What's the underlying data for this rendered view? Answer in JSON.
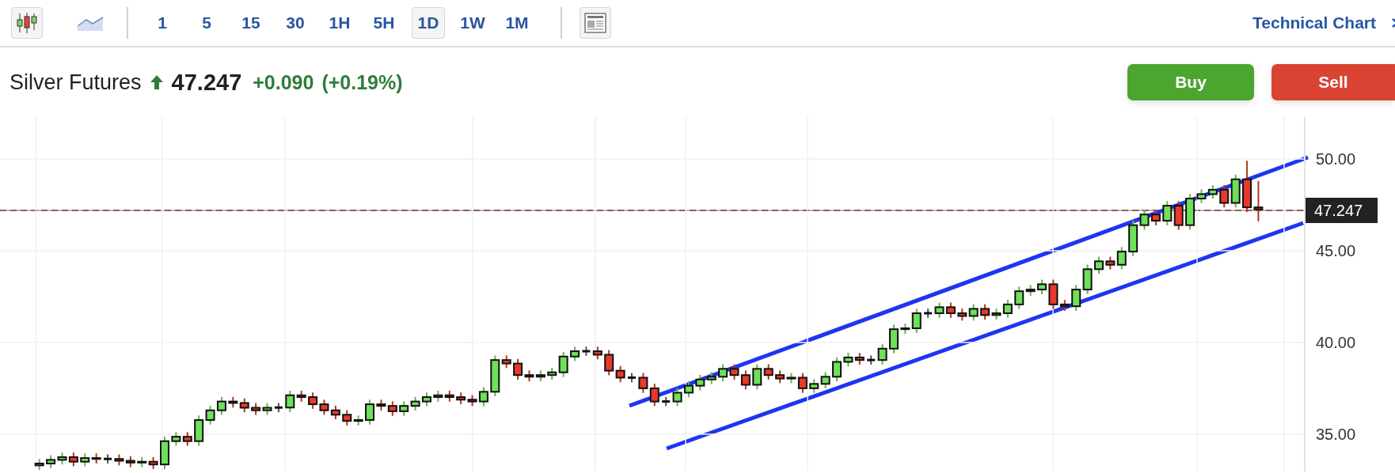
{
  "toolbar": {
    "chart_types": [
      {
        "kind": "candles",
        "selected": true
      },
      {
        "kind": "area",
        "selected": false
      }
    ],
    "intervals": [
      {
        "label": "1",
        "selected": false
      },
      {
        "label": "5",
        "selected": false
      },
      {
        "label": "15",
        "selected": false
      },
      {
        "label": "30",
        "selected": false
      },
      {
        "label": "1H",
        "selected": false
      },
      {
        "label": "5H",
        "selected": false
      },
      {
        "label": "1D",
        "selected": true
      },
      {
        "label": "1W",
        "selected": false
      },
      {
        "label": "1M",
        "selected": false
      }
    ],
    "link": "Technical Chart"
  },
  "quote": {
    "name": "Silver Futures",
    "price": "47.247",
    "change": "+0.090",
    "change_pct": "(+0.19%)"
  },
  "buttons": [
    {
      "kind": "buy",
      "label": "Buy"
    },
    {
      "kind": "sell",
      "label": "Sell"
    }
  ],
  "chart": {
    "chart_data": {
      "type": "candlestick",
      "grid": true,
      "ylim": [
        32.97,
        52.28
      ],
      "yticks": [
        {
          "value": 35,
          "label": "35.00"
        },
        {
          "value": 40,
          "label": "40.00"
        },
        {
          "value": 45,
          "label": "45.00"
        },
        {
          "value": 50,
          "label": "50.00"
        }
      ],
      "ohlc": [
        [
          33.3,
          33.65,
          33.05,
          33.4
        ],
        [
          33.4,
          33.85,
          33.15,
          33.6
        ],
        [
          33.6,
          34.0,
          33.35,
          33.75
        ],
        [
          33.75,
          34.0,
          33.25,
          33.5
        ],
        [
          33.5,
          33.95,
          33.25,
          33.7
        ],
        [
          33.7,
          33.95,
          33.4,
          33.65
        ],
        [
          33.65,
          33.9,
          33.4,
          33.65
        ],
        [
          33.65,
          33.9,
          33.3,
          33.55
        ],
        [
          33.55,
          33.8,
          33.2,
          33.45
        ],
        [
          33.45,
          33.75,
          33.2,
          33.5
        ],
        [
          33.5,
          33.75,
          33.1,
          33.35
        ],
        [
          33.35,
          34.87,
          33.1,
          34.62
        ],
        [
          34.62,
          35.11,
          34.37,
          34.86
        ],
        [
          34.86,
          35.11,
          34.37,
          34.62
        ],
        [
          34.62,
          36.02,
          34.37,
          35.77
        ],
        [
          35.77,
          36.55,
          35.52,
          36.3
        ],
        [
          36.3,
          37.03,
          36.05,
          36.78
        ],
        [
          36.78,
          37.03,
          36.45,
          36.7
        ],
        [
          36.7,
          36.95,
          36.19,
          36.44
        ],
        [
          36.44,
          36.69,
          36.05,
          36.3
        ],
        [
          36.3,
          36.69,
          36.05,
          36.44
        ],
        [
          36.44,
          36.7,
          36.19,
          36.45
        ],
        [
          36.45,
          37.37,
          36.2,
          37.12
        ],
        [
          37.12,
          37.37,
          36.77,
          37.02
        ],
        [
          37.02,
          37.27,
          36.38,
          36.63
        ],
        [
          36.63,
          36.88,
          36.05,
          36.3
        ],
        [
          36.3,
          36.55,
          35.81,
          36.06
        ],
        [
          36.06,
          36.31,
          35.47,
          35.72
        ],
        [
          35.72,
          36.02,
          35.47,
          35.77
        ],
        [
          35.77,
          36.88,
          35.52,
          36.63
        ],
        [
          36.63,
          36.88,
          36.29,
          36.54
        ],
        [
          36.54,
          36.79,
          36.0,
          36.25
        ],
        [
          36.25,
          36.79,
          36.0,
          36.54
        ],
        [
          36.54,
          37.03,
          36.29,
          36.78
        ],
        [
          36.78,
          37.27,
          36.53,
          37.02
        ],
        [
          37.02,
          37.37,
          36.77,
          37.12
        ],
        [
          37.12,
          37.37,
          36.77,
          37.02
        ],
        [
          37.02,
          37.27,
          36.63,
          36.88
        ],
        [
          36.88,
          37.13,
          36.53,
          36.78
        ],
        [
          36.78,
          37.56,
          36.53,
          37.31
        ],
        [
          37.31,
          39.29,
          37.06,
          39.04
        ],
        [
          39.04,
          39.29,
          38.6,
          38.85
        ],
        [
          38.85,
          39.1,
          37.97,
          38.22
        ],
        [
          38.22,
          38.47,
          37.88,
          38.13
        ],
        [
          38.13,
          38.47,
          37.88,
          38.22
        ],
        [
          38.22,
          38.62,
          37.97,
          38.37
        ],
        [
          38.37,
          39.48,
          38.12,
          39.23
        ],
        [
          39.23,
          39.77,
          38.98,
          39.52
        ],
        [
          39.52,
          39.77,
          39.27,
          39.52
        ],
        [
          39.52,
          39.77,
          39.08,
          39.33
        ],
        [
          39.33,
          39.58,
          38.21,
          38.46
        ],
        [
          38.46,
          38.71,
          37.83,
          38.08
        ],
        [
          38.08,
          38.33,
          37.83,
          38.08
        ],
        [
          38.08,
          38.33,
          37.25,
          37.5
        ],
        [
          37.5,
          37.75,
          36.53,
          36.78
        ],
        [
          36.78,
          37.03,
          36.53,
          36.78
        ],
        [
          36.78,
          37.51,
          36.53,
          37.26
        ],
        [
          37.26,
          37.89,
          37.01,
          37.64
        ],
        [
          37.64,
          38.23,
          37.39,
          37.98
        ],
        [
          37.98,
          38.38,
          37.73,
          38.13
        ],
        [
          38.13,
          38.81,
          37.88,
          38.56
        ],
        [
          38.56,
          38.81,
          37.97,
          38.22
        ],
        [
          38.22,
          38.47,
          37.44,
          37.69
        ],
        [
          37.69,
          38.81,
          37.44,
          38.56
        ],
        [
          38.56,
          38.81,
          37.97,
          38.22
        ],
        [
          38.22,
          38.47,
          37.78,
          38.03
        ],
        [
          38.03,
          38.33,
          37.78,
          38.08
        ],
        [
          38.08,
          38.33,
          37.25,
          37.5
        ],
        [
          37.5,
          37.99,
          37.25,
          37.74
        ],
        [
          37.74,
          38.38,
          37.49,
          38.13
        ],
        [
          38.13,
          39.19,
          37.88,
          38.94
        ],
        [
          38.94,
          39.43,
          38.69,
          39.18
        ],
        [
          39.18,
          39.43,
          38.79,
          39.04
        ],
        [
          39.04,
          39.29,
          38.79,
          39.04
        ],
        [
          39.04,
          39.91,
          38.79,
          39.66
        ],
        [
          39.66,
          40.97,
          39.41,
          40.72
        ],
        [
          40.72,
          41.02,
          40.47,
          40.77
        ],
        [
          40.77,
          41.84,
          40.52,
          41.59
        ],
        [
          41.59,
          41.84,
          41.34,
          41.59
        ],
        [
          41.59,
          42.17,
          41.34,
          41.92
        ],
        [
          41.92,
          42.17,
          41.34,
          41.59
        ],
        [
          41.59,
          41.84,
          41.19,
          41.44
        ],
        [
          41.44,
          42.08,
          41.19,
          41.83
        ],
        [
          41.83,
          42.08,
          41.24,
          41.49
        ],
        [
          41.49,
          41.84,
          41.24,
          41.59
        ],
        [
          41.59,
          42.32,
          41.34,
          42.07
        ],
        [
          42.07,
          43.04,
          41.82,
          42.79
        ],
        [
          42.79,
          43.13,
          42.54,
          42.88
        ],
        [
          42.88,
          43.42,
          42.63,
          43.17
        ],
        [
          43.17,
          43.42,
          41.82,
          42.07
        ],
        [
          42.07,
          42.32,
          41.72,
          41.97
        ],
        [
          41.97,
          43.13,
          41.72,
          42.88
        ],
        [
          42.88,
          44.24,
          42.63,
          43.99
        ],
        [
          43.99,
          44.67,
          43.74,
          44.42
        ],
        [
          44.42,
          44.67,
          43.98,
          44.23
        ],
        [
          44.23,
          45.2,
          43.98,
          44.95
        ],
        [
          44.95,
          46.64,
          44.7,
          46.39
        ],
        [
          46.39,
          47.22,
          46.14,
          46.97
        ],
        [
          46.97,
          47.22,
          46.38,
          46.63
        ],
        [
          46.63,
          47.7,
          46.38,
          47.45
        ],
        [
          47.45,
          47.7,
          46.14,
          46.39
        ],
        [
          46.39,
          48.09,
          46.14,
          47.84
        ],
        [
          47.84,
          48.33,
          47.59,
          48.08
        ],
        [
          48.08,
          48.57,
          47.83,
          48.32
        ],
        [
          48.32,
          48.57,
          47.35,
          47.6
        ],
        [
          47.6,
          49.14,
          47.35,
          48.89
        ],
        [
          48.89,
          49.9,
          47.11,
          47.36
        ],
        [
          47.36,
          48.8,
          46.6,
          47.25
        ]
      ]
    },
    "price_tag": "47.247"
  }
}
